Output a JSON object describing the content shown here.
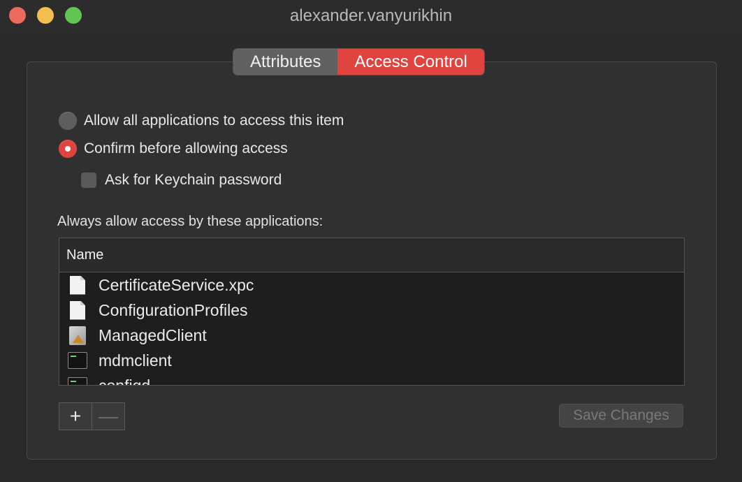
{
  "window": {
    "title": "alexander.vanyurikhin"
  },
  "tabs": [
    {
      "label": "Attributes",
      "active": false
    },
    {
      "label": "Access Control",
      "active": true
    }
  ],
  "access": {
    "option_allow_all": "Allow all applications to access this item",
    "option_confirm": "Confirm before allowing access",
    "ask_keychain": "Ask for Keychain password",
    "selected": "confirm",
    "ask_keychain_checked": false
  },
  "apps_section": {
    "label": "Always allow access by these applications:",
    "column_header": "Name",
    "rows": [
      {
        "name": "CertificateService.xpc",
        "icon": "document-icon"
      },
      {
        "name": "ConfigurationProfiles",
        "icon": "document-icon"
      },
      {
        "name": "ManagedClient",
        "icon": "app-icon"
      },
      {
        "name": "mdmclient",
        "icon": "terminal-icon"
      },
      {
        "name": "configd",
        "icon": "terminal-icon"
      }
    ]
  },
  "buttons": {
    "add": "+",
    "remove": "—",
    "save": "Save Changes"
  },
  "colors": {
    "accent": "#e0443e",
    "background": "#2a2a2a"
  }
}
